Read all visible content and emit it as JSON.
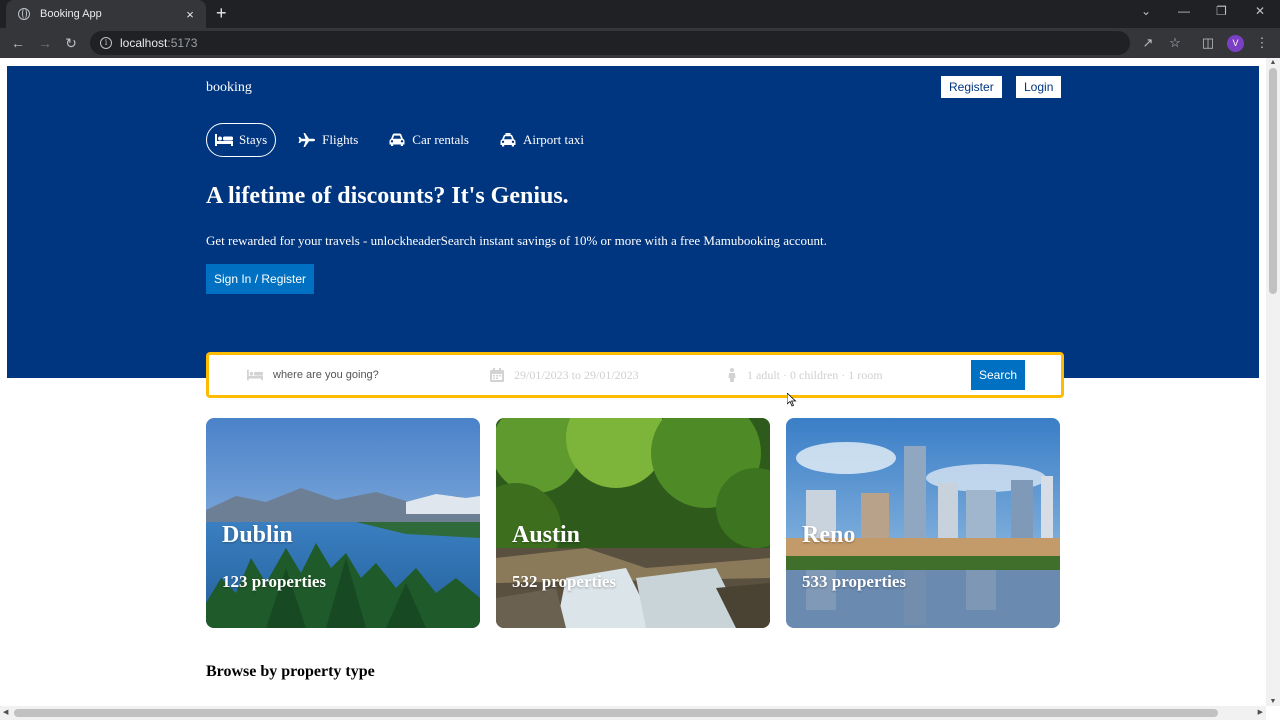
{
  "browser": {
    "tab_title": "Booking App",
    "tab_close": "×",
    "new_tab": "+",
    "url_host": "localhost",
    "url_port": ":5173",
    "profile_initial": "V"
  },
  "header": {
    "brand": "booking",
    "register_label": "Register",
    "login_label": "Login",
    "nav": [
      {
        "label": "Stays",
        "icon": "bed-icon",
        "active": true
      },
      {
        "label": "Flights",
        "icon": "plane-icon",
        "active": false
      },
      {
        "label": "Car rentals",
        "icon": "car-icon",
        "active": false
      },
      {
        "label": "Airport taxi",
        "icon": "taxi-icon",
        "active": false
      }
    ],
    "headline": "A lifetime of discounts? It's Genius.",
    "subline": "Get rewarded for your travels - unlockheaderSearch instant savings of 10% or more with a free Mamubooking account.",
    "signin_label": "Sign In / Register"
  },
  "search": {
    "destination_placeholder": "where are you going?",
    "dates": "29/01/2023 to 29/01/2023",
    "guests": "1 adult · 0 children · 1 room",
    "button_label": "Search",
    "border_color": "#febb02"
  },
  "featured": [
    {
      "city": "Dublin",
      "properties": "123 properties"
    },
    {
      "city": "Austin",
      "properties": "532 properties"
    },
    {
      "city": "Reno",
      "properties": "533 properties"
    }
  ],
  "section_title": "Browse by property type",
  "colors": {
    "header_bg": "#003580",
    "button_blue": "#0071c2",
    "accent_yellow": "#febb02"
  }
}
